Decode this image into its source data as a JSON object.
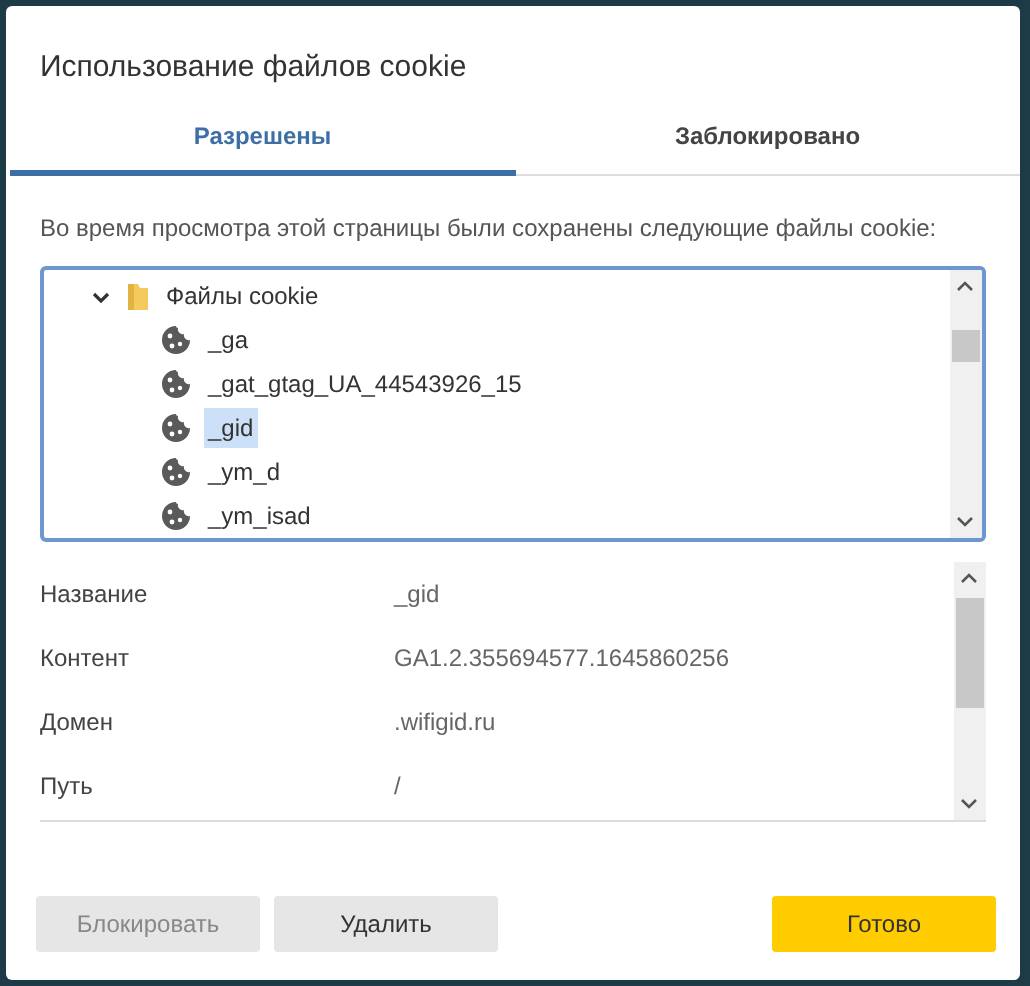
{
  "dialog": {
    "title": "Использование файлов cookie"
  },
  "tabs": [
    {
      "label": "Разрешены",
      "selected": true
    },
    {
      "label": "Заблокировано",
      "selected": false
    }
  ],
  "description": "Во время просмотра этой страницы были сохранены следующие файлы cookie:",
  "tree": [
    {
      "label": "Файлы cookie",
      "kind": "folder",
      "expanded": true,
      "selected": false,
      "children": [
        {
          "label": "_ga",
          "kind": "cookie",
          "selected": false
        },
        {
          "label": "_gat_gtag_UA_44543926_15",
          "kind": "cookie",
          "selected": false
        },
        {
          "label": "_gid",
          "kind": "cookie",
          "selected": true
        },
        {
          "label": "_ym_d",
          "kind": "cookie",
          "selected": false
        },
        {
          "label": "_ym_isad",
          "kind": "cookie",
          "selected": false
        }
      ]
    }
  ],
  "details": [
    {
      "label": "Название",
      "value": "_gid"
    },
    {
      "label": "Контент",
      "value": "GA1.2.355694577.1645860256"
    },
    {
      "label": "Домен",
      "value": ".wifigid.ru"
    },
    {
      "label": "Путь",
      "value": "/"
    }
  ],
  "buttons": [
    {
      "label": "Блокировать",
      "kind": "secondary",
      "disabled": true
    },
    {
      "label": "Удалить",
      "kind": "secondary",
      "disabled": false
    },
    {
      "label": "Готово",
      "kind": "primary",
      "disabled": false
    }
  ]
}
